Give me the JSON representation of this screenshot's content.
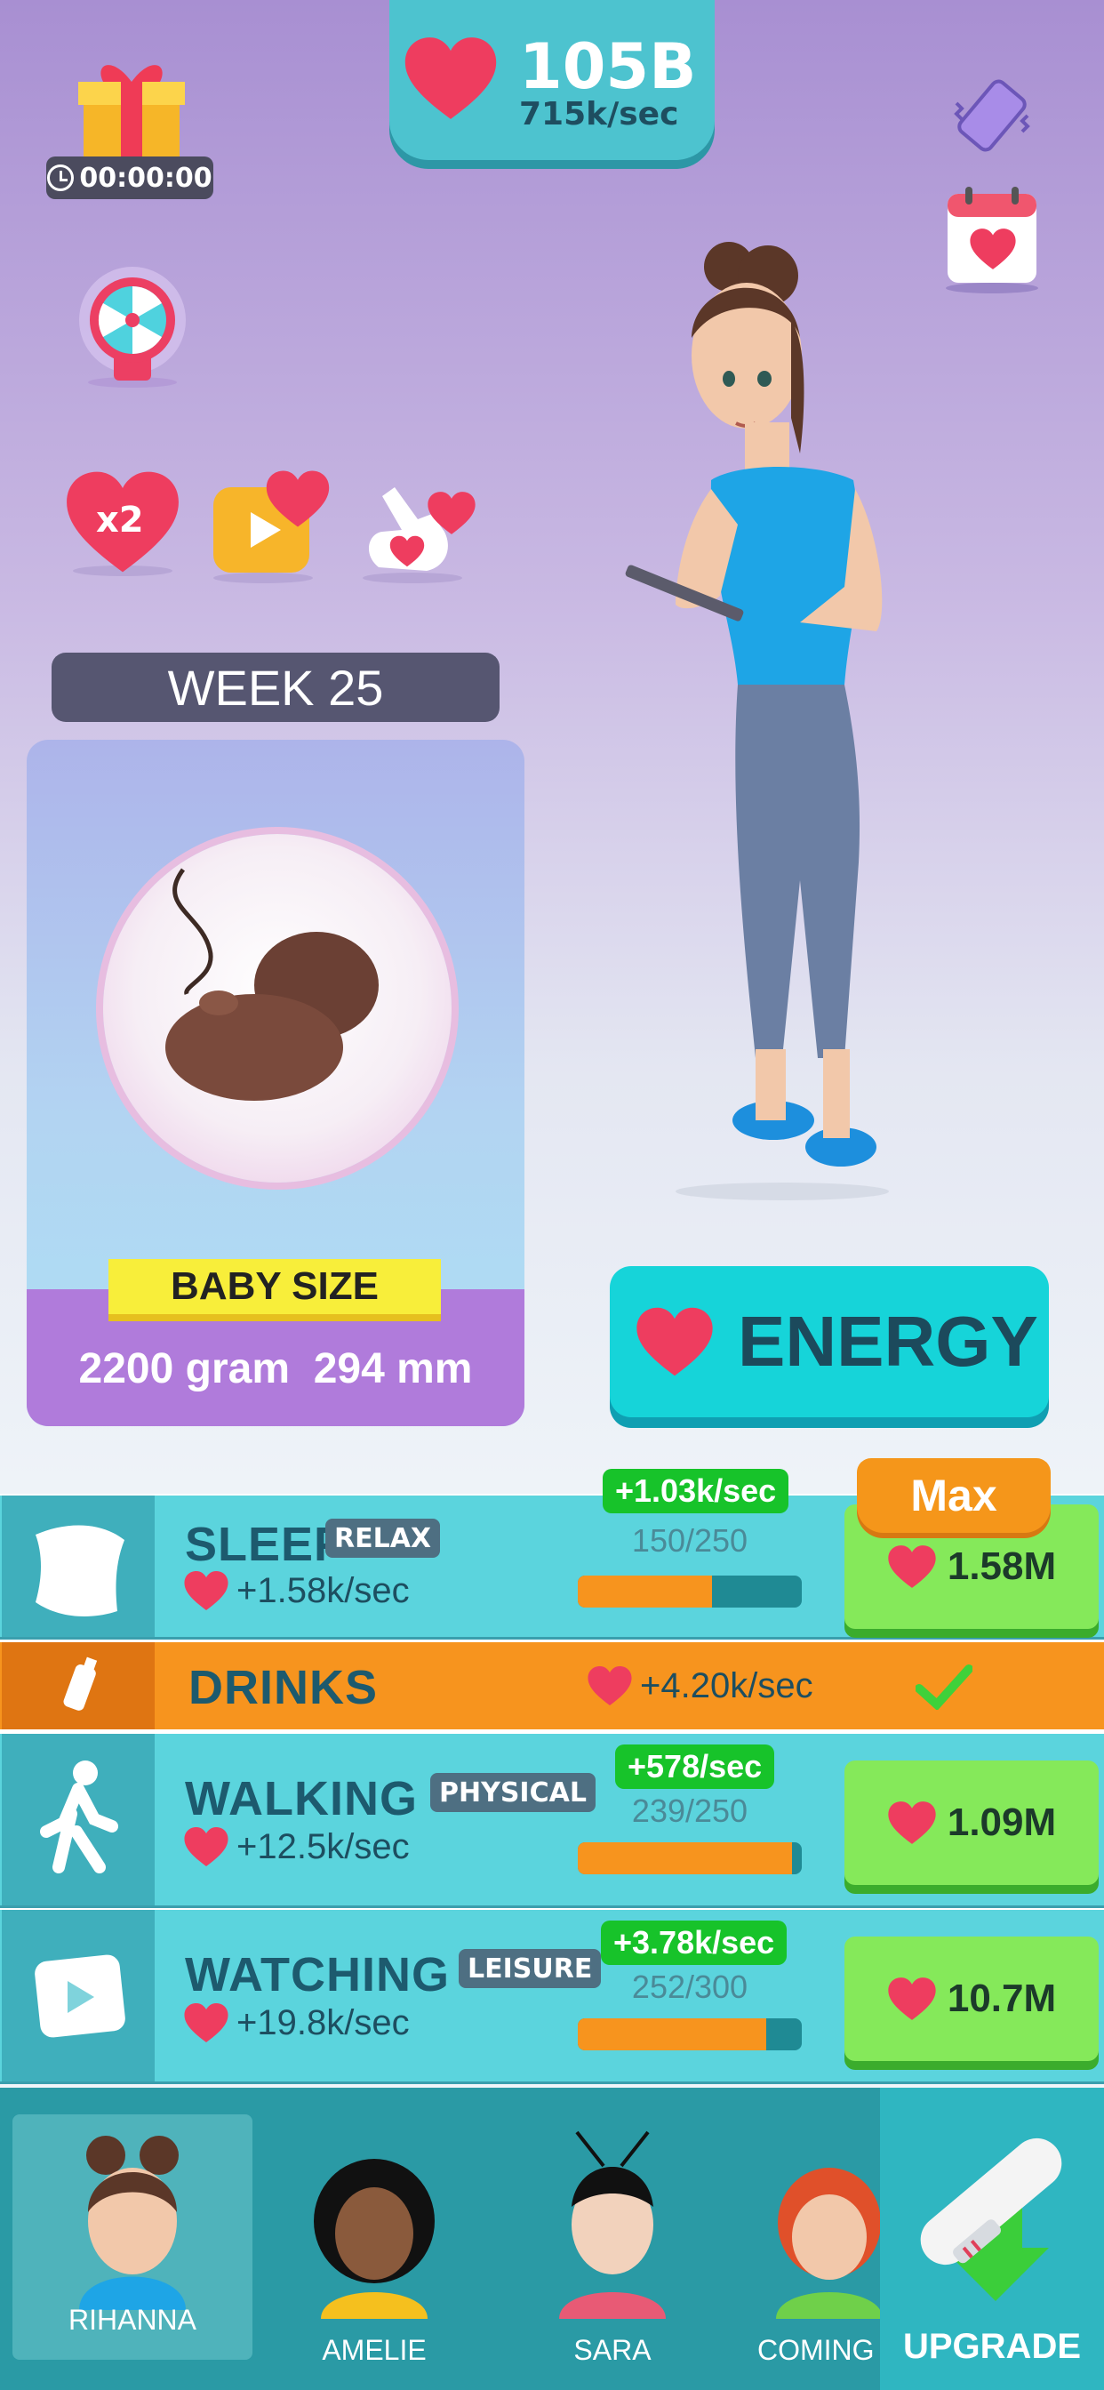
{
  "currency": {
    "total": "105B",
    "rate": "715k/sec"
  },
  "timer": {
    "value": "00:00:00"
  },
  "boosts": {
    "x2": "x2"
  },
  "week": {
    "label": "WEEK 25"
  },
  "baby": {
    "size_label": "BABY SIZE",
    "weight": "2200 gram",
    "length": "294 mm"
  },
  "energy": {
    "label": "ENERGY"
  },
  "activities": [
    {
      "name": "SLEEP",
      "tag": "RELAX",
      "rate": "+1.58k/sec",
      "badge": "+1.03k/sec",
      "count": "150/250",
      "progress": 0.6,
      "price": "1.58M",
      "max_label": "Max"
    },
    {
      "name": "DRINKS",
      "rate": "+4.20k/sec",
      "status": "completed"
    },
    {
      "name": "WALKING",
      "tag": "PHYSICAL",
      "rate": "+12.5k/sec",
      "badge": "+578/sec",
      "count": "239/250",
      "progress": 0.956,
      "price": "1.09M"
    },
    {
      "name": "WATCHING",
      "tag": "LEISURE",
      "rate": "+19.8k/sec",
      "badge": "+3.78k/sec",
      "count": "252/300",
      "progress": 0.84,
      "price": "10.7M"
    }
  ],
  "characters": [
    {
      "name": "RIHANNA",
      "active": true
    },
    {
      "name": "AMELIE"
    },
    {
      "name": "SARA"
    },
    {
      "name": "COMING S"
    }
  ],
  "upgrade": {
    "label": "UPGRADE"
  },
  "colors": {
    "teal": "#5bd4dd",
    "orange": "#f7941e",
    "green": "#85e95a",
    "heart": "#ee3d5f"
  }
}
